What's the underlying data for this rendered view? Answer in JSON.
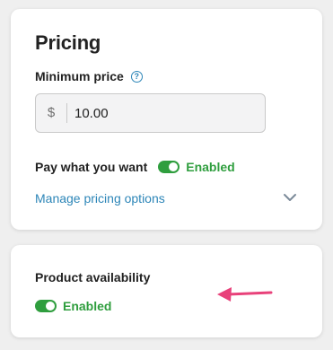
{
  "pricing": {
    "title": "Pricing",
    "min_price_label": "Minimum price",
    "help_icon": "question-circle-icon",
    "currency_symbol": "$",
    "min_price_value": "10.00",
    "pwyw_label": "Pay what you want",
    "pwyw_status": "Enabled",
    "manage_link": "Manage pricing options",
    "expand_icon": "chevron-down-icon"
  },
  "availability": {
    "title": "Product availability",
    "status": "Enabled"
  },
  "colors": {
    "accent_link": "#2d86b8",
    "toggle_on": "#2f9e3e",
    "annotation_arrow": "#e8417a"
  }
}
